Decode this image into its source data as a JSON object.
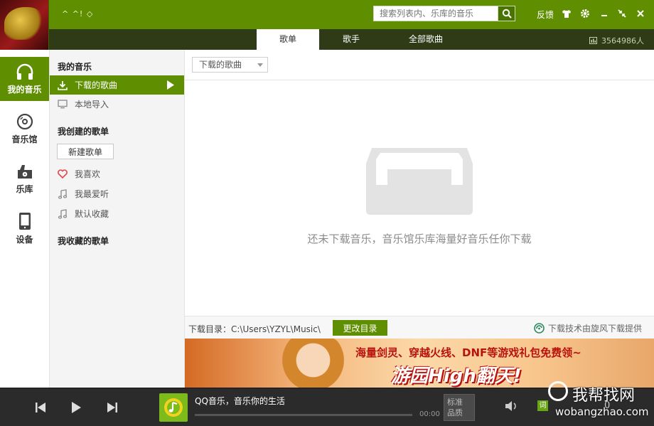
{
  "titlebar": {
    "title_text": "^ ^! ◇",
    "search_placeholder": "搜索列表内、乐库的音乐",
    "feedback": "反馈"
  },
  "tabs": [
    {
      "label": "歌单",
      "active": true
    },
    {
      "label": "歌手",
      "active": false
    },
    {
      "label": "全部歌曲",
      "active": false
    }
  ],
  "online_count": "3564986人",
  "leftnav": [
    {
      "label": "我的音乐",
      "icon": "headphones-icon",
      "active": true
    },
    {
      "label": "音乐馆",
      "icon": "disc-icon",
      "active": false
    },
    {
      "label": "乐库",
      "icon": "library-icon",
      "active": false
    },
    {
      "label": "设备",
      "icon": "device-icon",
      "active": false
    }
  ],
  "sidebar": {
    "my_music_title": "我的音乐",
    "my_music_items": [
      {
        "label": "下载的歌曲",
        "icon": "download-icon",
        "active": true
      },
      {
        "label": "本地导入",
        "icon": "monitor-icon",
        "active": false
      }
    ],
    "created_title": "我创建的歌单",
    "new_playlist": "新建歌单",
    "created_items": [
      {
        "label": "我喜欢",
        "icon": "heart-icon"
      },
      {
        "label": "我最爱听",
        "icon": "music-note-icon"
      },
      {
        "label": "默认收藏",
        "icon": "music-note-icon"
      }
    ],
    "collected_title": "我收藏的歌单"
  },
  "main": {
    "filter_value": "下载的歌曲",
    "empty_message": "还未下载音乐，音乐馆乐库海量好音乐任你下载"
  },
  "dirbar": {
    "label": "下载目录：C:\\Users\\YZYL\\Music\\",
    "change_button": "更改目录",
    "provider": "下载技术由旋风下载提供"
  },
  "banner": {
    "line1": "海量剑灵、穿越火线、DNF等游戏礼包免费领~",
    "line2": "游园High翻天!"
  },
  "player": {
    "track_title": "QQ音乐，音乐你的生活",
    "time": "00:00",
    "progress": 0,
    "quality": "标准\n品质",
    "lyric": "词",
    "playlist_count": "0"
  },
  "watermark": {
    "line1": "我帮找网",
    "line2": "wobangzhao.com"
  },
  "colors": {
    "brand_green": "#5f8f00",
    "dark_tabbar": "#2f3a17",
    "player_bg": "#2b2b2b"
  }
}
